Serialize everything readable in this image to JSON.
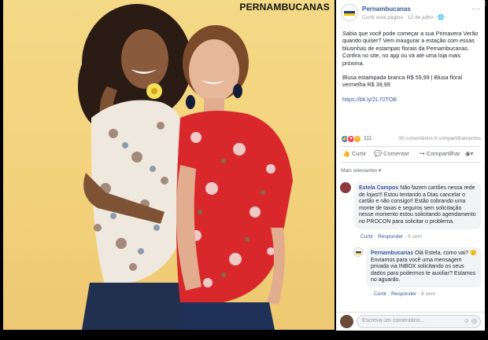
{
  "photo": {
    "brand": "PERNAMBUCANAS"
  },
  "post": {
    "page_name": "Pernambucanas",
    "meta": "Curtir esta página · 12 de julho · ",
    "more": "···",
    "text_p1": "Sabia que você pode começar a sua Primavera Verão quando quiser? Vem inaugurar a estação com essas blusinhas de estampas florais da Pernambucanas. Confira no site, no app ou vá até uma loja mais próxima.",
    "text_p2": "Blusa estampada branca R$ 59,99 | Blusa floral vermelha R$ 39,99",
    "link": "https://bit.ly/2L70TOB",
    "reactions_count": "111",
    "reactions_right": "30 comentários  6 compartilhamentos",
    "actions": {
      "like": "Curtir",
      "comment": "Comentar",
      "share": "Compartilhar"
    },
    "relevant_label": "Mais relevantes ▾"
  },
  "comments": [
    {
      "author": "Estela Campos",
      "text": "Não fazem cartões nessa rede de lojas!!! Estou tentando a Dias cancelar o cartão e não consigo!! Estão cobrando uma monte de taxas e seguros sem solicitação nesse momento estou solicitando agendamento no PROCON para solicitar o problema.",
      "like": "Curtir",
      "reply": "Responder",
      "time": "6 sem"
    },
    {
      "author": "Pernambucanas",
      "text": "Olá Estela, como vai? 🙂 Enviamos para você uma mensagem privada via INBOX solicitando os seus dados para podermos te auxiliar? Estamos no aguardo.",
      "like": "Curtir",
      "reply": "Responder",
      "time": "6 sem"
    }
  ],
  "write_comment": {
    "placeholder": "Escreva um comentário..."
  },
  "window": {
    "close": "✕"
  },
  "colors": {
    "link": "#385898",
    "photo_bg": "#f3d27c",
    "blouse_red": "#d8282b"
  }
}
